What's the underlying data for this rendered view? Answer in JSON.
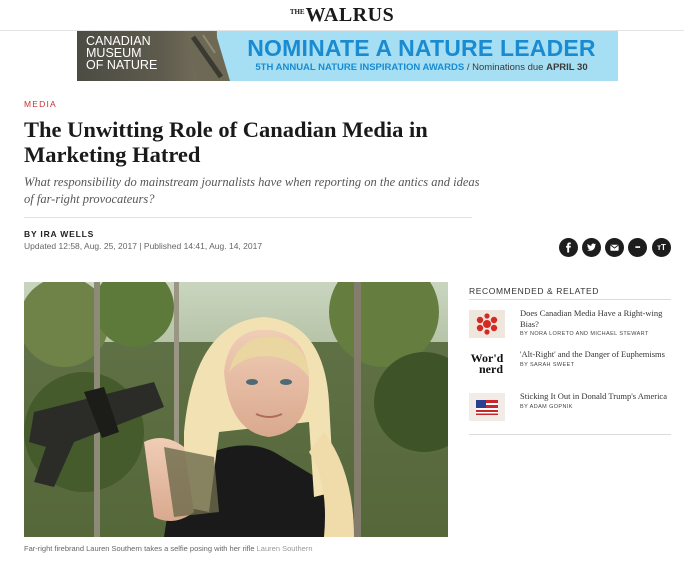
{
  "site": {
    "logo_the": "THE",
    "logo_name": "WALRUS"
  },
  "ad": {
    "museum_lines": [
      "Canadian",
      "Museum",
      "of Nature"
    ],
    "headline": "NOMINATE A NATURE LEADER",
    "sub_part1": "5TH ANNUAL NATURE INSPIRATION AWARDS",
    "sub_part2": " / Nominations due ",
    "sub_part3": "APRIL 30"
  },
  "article": {
    "section": "MEDIA",
    "title": "The Unwitting Role of Canadian Media in Marketing Hatred",
    "dek": "What responsibility do mainstream journalists have when reporting on the antics and ideas of far-right provocateurs?",
    "byline": "BY IRA WELLS",
    "updated": "Updated 12:58, Aug. 25, 2017",
    "separator": " | ",
    "published": "Published 14:41, Aug. 14, 2017",
    "caption": "Far-right firebrand Lauren Southern takes a selfie posing with her rifle",
    "credit": "Lauren Southern"
  },
  "share": {
    "icons": [
      "facebook-icon",
      "twitter-icon",
      "email-icon",
      "more-icon",
      "text-size-icon"
    ],
    "more_glyph": "•••",
    "text_size_glyph": "тT"
  },
  "related": {
    "heading": "RECOMMENDED & RELATED",
    "items": [
      {
        "title": "Does Canadian Media Have a Right-wing Bias?",
        "author": "BY NORA LORETO AND MICHAEL STEWART"
      },
      {
        "title": "'Alt-Right' and the Danger of Euphemisms",
        "author": "BY SARAH SWEET",
        "thumb_text_1": "Wor'd",
        "thumb_text_2": "nerd"
      },
      {
        "title": "Sticking It Out in Donald Trump's America",
        "author": "BY ADAM GOPNIK"
      }
    ]
  },
  "colors": {
    "accent_red": "#c6332f",
    "ad_blue": "#1a8bd0",
    "ad_bg": "#a6dff4",
    "share_bg": "#1d1d1d"
  }
}
